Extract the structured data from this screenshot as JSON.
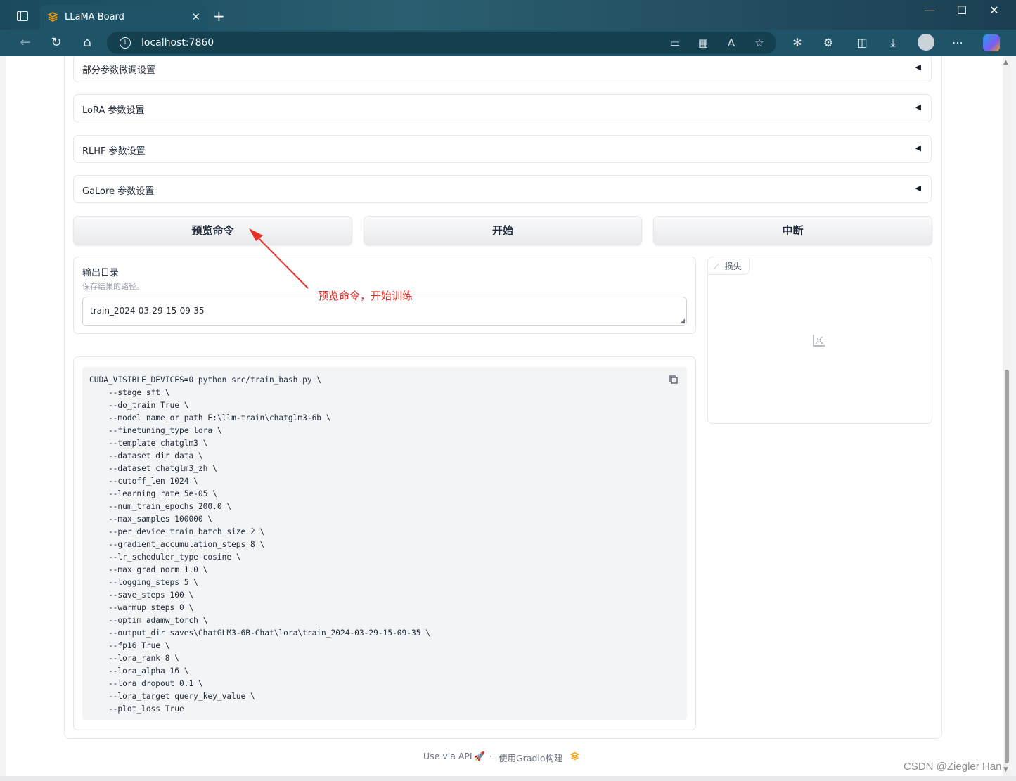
{
  "browser": {
    "tab_title": "LLaMA Board",
    "url": "localhost:7860"
  },
  "accordions": [
    {
      "label": "部分参数微调设置"
    },
    {
      "label": "LoRA 参数设置"
    },
    {
      "label": "RLHF 参数设置"
    },
    {
      "label": "GaLore 参数设置"
    }
  ],
  "buttons": {
    "preview": "预览命令",
    "start": "开始",
    "abort": "中断"
  },
  "output_dir": {
    "label": "输出目录",
    "info": "保存结果的路径。",
    "value": "train_2024-03-29-15-09-35"
  },
  "plot": {
    "label": "损失"
  },
  "command_preview": {
    "text": "CUDA_VISIBLE_DEVICES=0 python src/train_bash.py \\\n    --stage sft \\\n    --do_train True \\\n    --model_name_or_path E:\\llm-train\\chatglm3-6b \\\n    --finetuning_type lora \\\n    --template chatglm3 \\\n    --dataset_dir data \\\n    --dataset chatglm3_zh \\\n    --cutoff_len 1024 \\\n    --learning_rate 5e-05 \\\n    --num_train_epochs 200.0 \\\n    --max_samples 100000 \\\n    --per_device_train_batch_size 2 \\\n    --gradient_accumulation_steps 8 \\\n    --lr_scheduler_type cosine \\\n    --max_grad_norm 1.0 \\\n    --logging_steps 5 \\\n    --save_steps 100 \\\n    --warmup_steps 0 \\\n    --optim adamw_torch \\\n    --output_dir saves\\ChatGLM3-6B-Chat\\lora\\train_2024-03-29-15-09-35 \\\n    --fp16 True \\\n    --lora_rank 8 \\\n    --lora_alpha 16 \\\n    --lora_dropout 0.1 \\\n    --lora_target query_key_value \\\n    --plot_loss True"
  },
  "annotation": {
    "text": "预览命令，开始训练",
    "color": "#e8302a"
  },
  "footer": {
    "api_link": "Use via API",
    "separator": "·",
    "built_with": "使用Gradio构建"
  },
  "watermark": "CSDN @Ziegler Han"
}
